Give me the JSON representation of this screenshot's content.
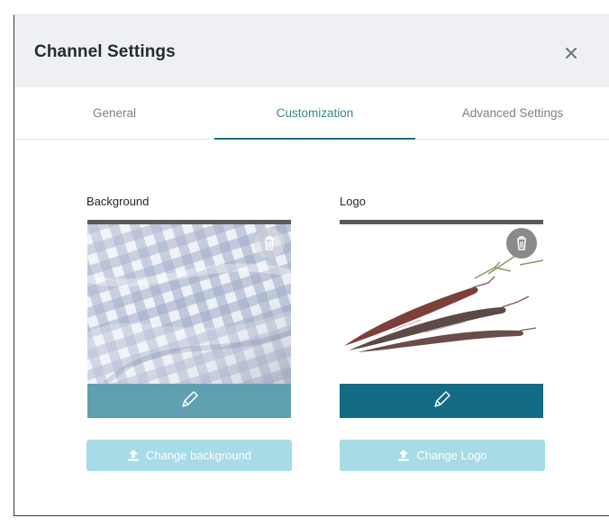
{
  "dialog": {
    "title": "Channel Settings"
  },
  "tabs": [
    {
      "label": "General",
      "active": false
    },
    {
      "label": "Customization",
      "active": true
    },
    {
      "label": "Advanced Settings",
      "active": false
    }
  ],
  "background": {
    "label": "Background",
    "button_label": "Change background"
  },
  "logo": {
    "label": "Logo",
    "button_label": "Change Logo"
  },
  "colors": {
    "header_bg": "#eef0f3",
    "accent": "#1c6f82",
    "active_tab_text": "#3b8591",
    "button_bg": "#a7dbe6",
    "footer_teal": "#136b85"
  },
  "icons": [
    "close-icon",
    "trash-icon",
    "pencil-icon",
    "upload-icon"
  ]
}
